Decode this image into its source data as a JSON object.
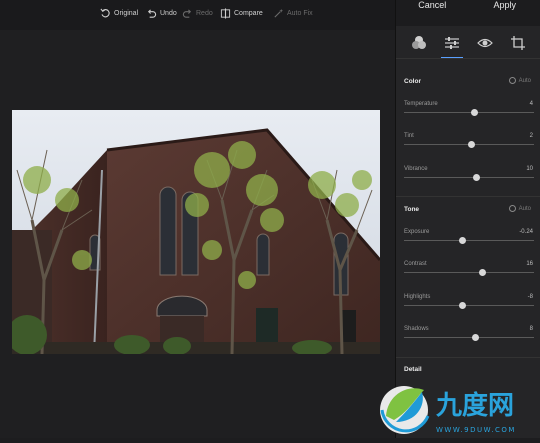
{
  "toolbar": {
    "original": "Original",
    "undo": "Undo",
    "redo": "Redo",
    "compare": "Compare",
    "autofix": "Auto Fix"
  },
  "panel": {
    "cancel": "Cancel",
    "apply": "Apply",
    "tabs": [
      "filters-icon",
      "adjust-icon",
      "eye-icon",
      "crop-icon"
    ],
    "color": {
      "title": "Color",
      "auto": "Auto",
      "sliders": [
        {
          "label": "Temperature",
          "value": "4",
          "fraction": 0.54
        },
        {
          "label": "Tint",
          "value": "2",
          "fraction": 0.52
        },
        {
          "label": "Vibrance",
          "value": "10",
          "fraction": 0.56
        }
      ]
    },
    "tone": {
      "title": "Tone",
      "auto": "Auto",
      "sliders": [
        {
          "label": "Exposure",
          "value": "-0.24",
          "fraction": 0.45
        },
        {
          "label": "Contrast",
          "value": "16",
          "fraction": 0.6
        },
        {
          "label": "Highlights",
          "value": "-8",
          "fraction": 0.45
        },
        {
          "label": "Shadows",
          "value": "8",
          "fraction": 0.55
        }
      ]
    },
    "detail": {
      "title": "Detail"
    }
  },
  "watermark": {
    "brand": "九度网",
    "url": "WWW.9DUW.COM"
  },
  "colors": {
    "accent": "#5aa0ff",
    "panel": "#252527",
    "canvas": "#1f1f21"
  }
}
